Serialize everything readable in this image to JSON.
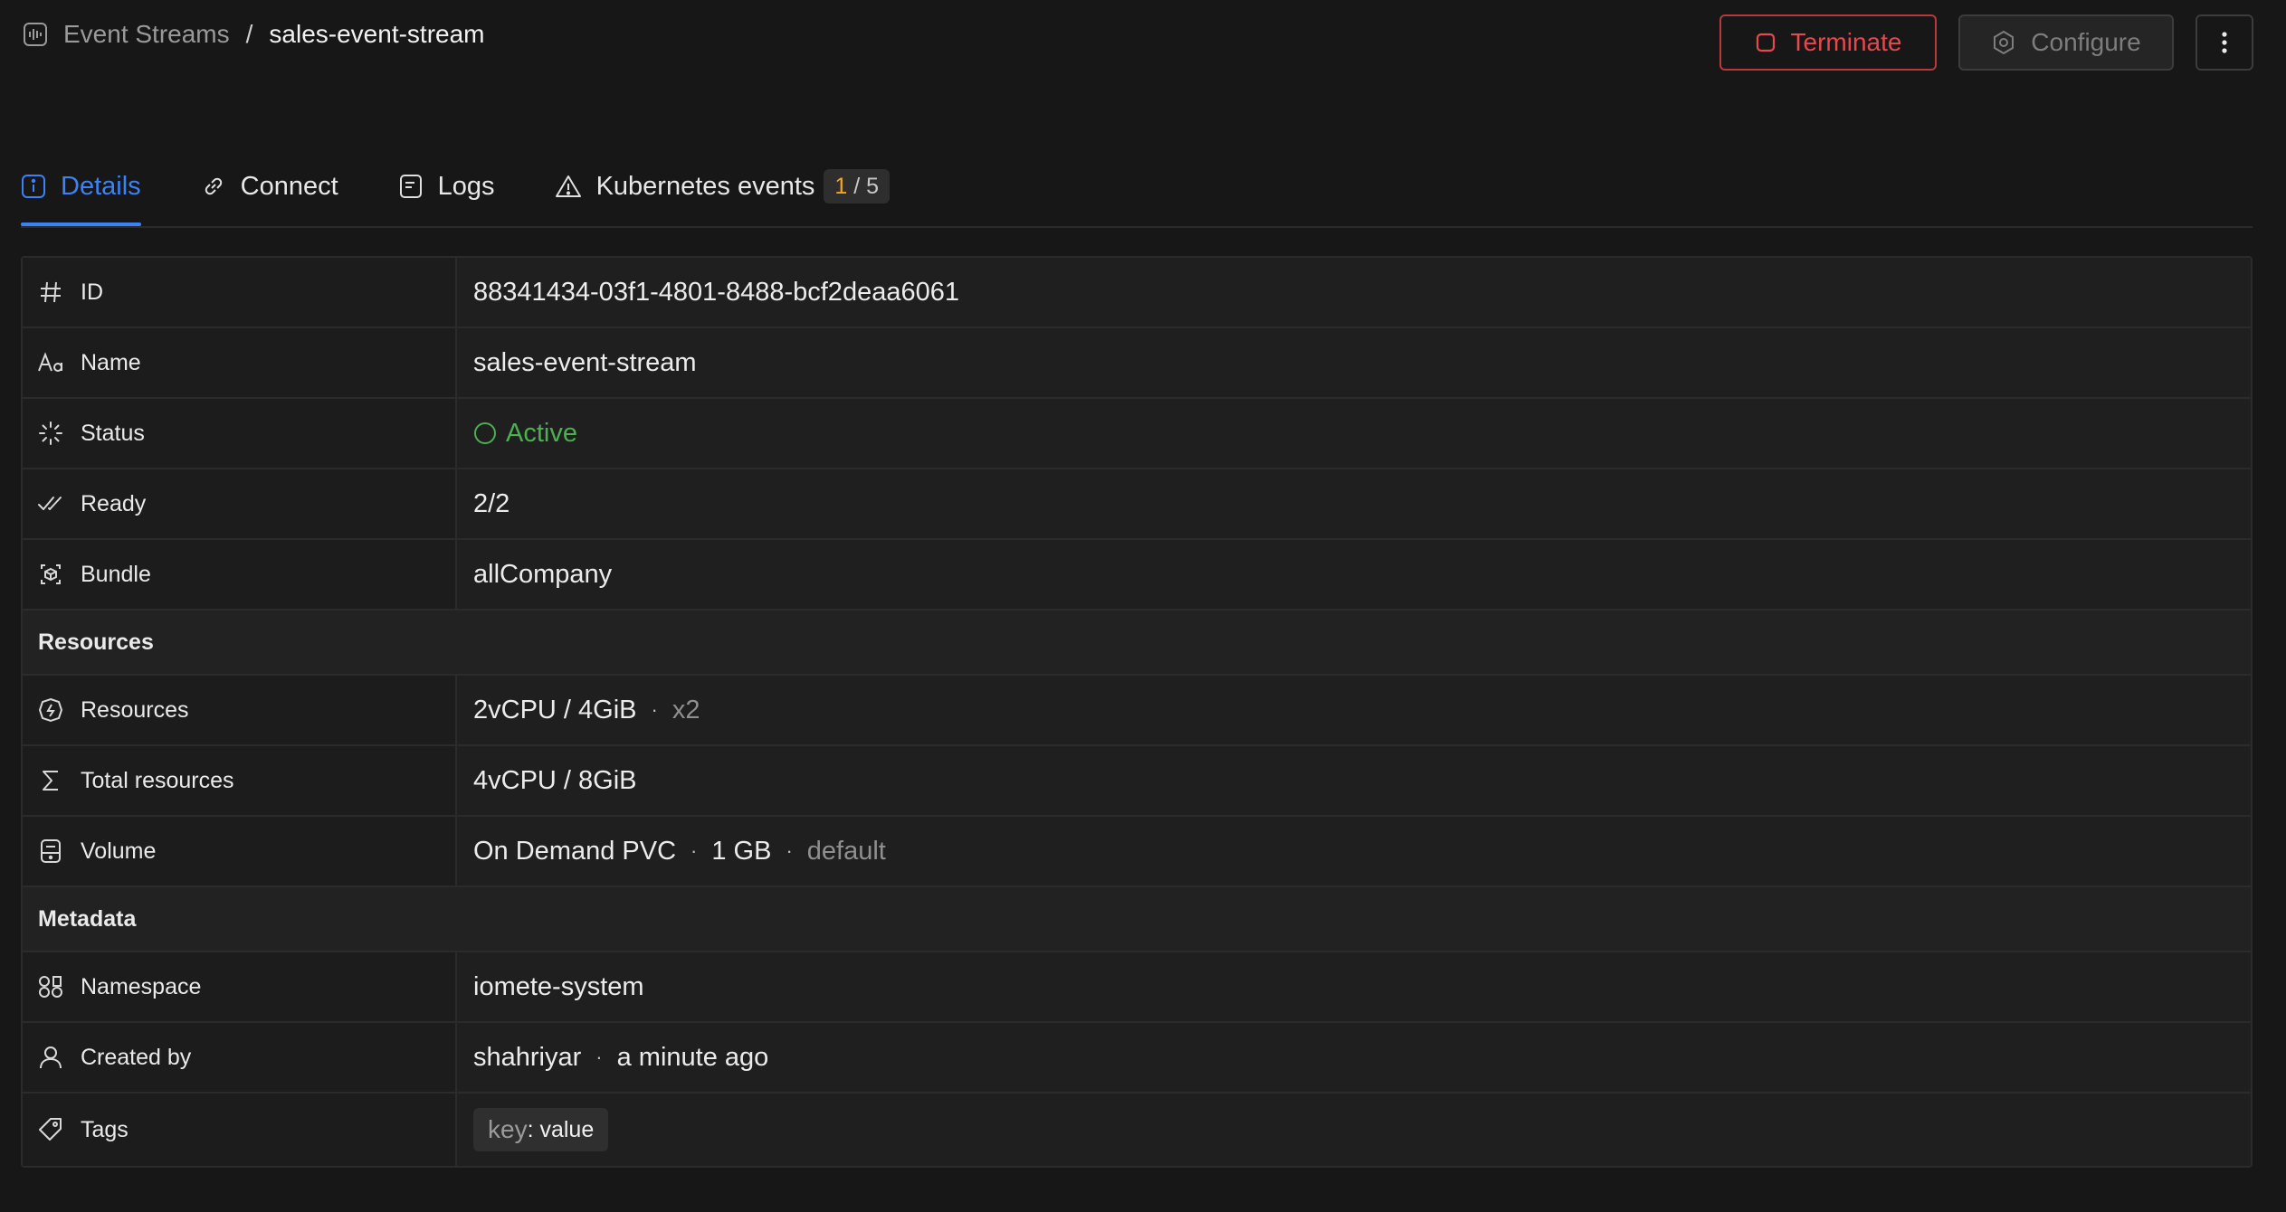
{
  "breadcrumb": {
    "root": "Event Streams",
    "separator": "/",
    "current": "sales-event-stream"
  },
  "actions": {
    "terminate_label": "Terminate",
    "configure_label": "Configure"
  },
  "tabs": [
    {
      "label": "Details",
      "active": true
    },
    {
      "label": "Connect",
      "active": false
    },
    {
      "label": "Logs",
      "active": false
    },
    {
      "label": "Kubernetes events",
      "active": false,
      "badge_warn": "1",
      "badge_total": "/ 5"
    }
  ],
  "details": {
    "id": {
      "label": "ID",
      "value": "88341434-03f1-4801-8488-bcf2deaa6061"
    },
    "name": {
      "label": "Name",
      "value": "sales-event-stream"
    },
    "status": {
      "label": "Status",
      "value": "Active"
    },
    "ready": {
      "label": "Ready",
      "value": "2/2"
    },
    "bundle": {
      "label": "Bundle",
      "value": "allCompany"
    }
  },
  "resources_section": {
    "title": "Resources",
    "resources": {
      "label": "Resources",
      "value": "2vCPU / 4GiB",
      "multiplier": "x2"
    },
    "total": {
      "label": "Total resources",
      "value": "4vCPU / 8GiB"
    },
    "volume": {
      "label": "Volume",
      "type": "On Demand PVC",
      "size": "1 GB",
      "class": "default"
    }
  },
  "metadata_section": {
    "title": "Metadata",
    "namespace": {
      "label": "Namespace",
      "value": "iomete-system"
    },
    "created_by": {
      "label": "Created by",
      "user": "shahriyar",
      "time": "a minute ago"
    },
    "tags": {
      "label": "Tags",
      "items": [
        {
          "key": "key",
          "value": ": value"
        }
      ]
    }
  },
  "separator_dot": "·",
  "colors": {
    "accent": "#3b82f6",
    "danger": "#e5484d",
    "success": "#4caf50",
    "warning": "#f5a524"
  }
}
